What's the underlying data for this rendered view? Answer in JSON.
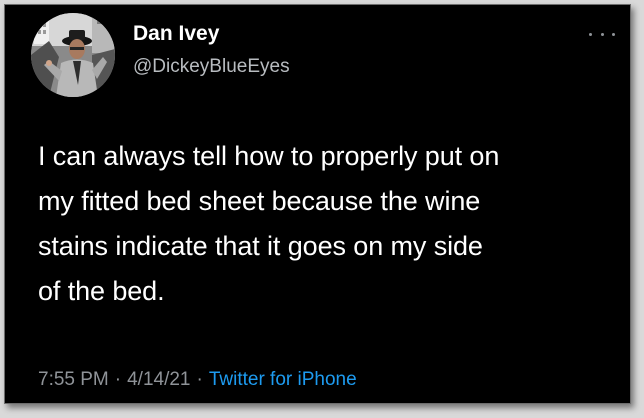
{
  "tweet": {
    "author": {
      "display_name": "Dan Ivey",
      "handle": "@DickeyBlueEyes"
    },
    "text_lines": [
      "I can always tell how to properly put on",
      "my fitted bed sheet because the wine",
      "stains indicate that it goes on my side",
      "of the bed."
    ],
    "time": "7:55 PM",
    "date": "4/14/21",
    "separator": "·",
    "source": "Twitter for iPhone",
    "more_icon": "more-horizontal-icon"
  },
  "colors": {
    "background": "#000000",
    "primary_text": "#ffffff",
    "secondary_text": "#8f9398",
    "link": "#1d9bf0"
  }
}
